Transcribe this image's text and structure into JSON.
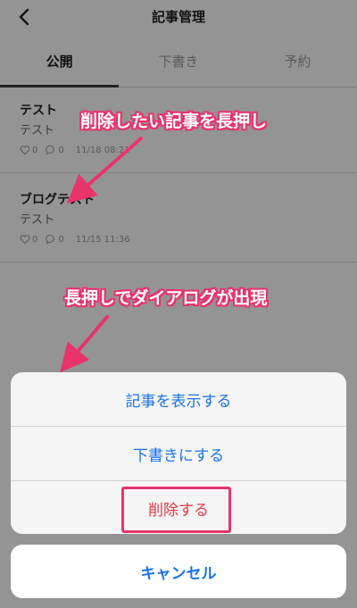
{
  "header": {
    "title": "記事管理",
    "back_icon": "chevron-left-icon"
  },
  "tabs": [
    {
      "label": "公開",
      "active": true
    },
    {
      "label": "下書き",
      "active": false
    },
    {
      "label": "予約",
      "active": false
    }
  ],
  "articles": [
    {
      "title": "テスト",
      "body": "テスト",
      "likes": "0",
      "comments": "0",
      "date": "11/18 08:21"
    },
    {
      "title": "ブログテスト",
      "body": "テスト",
      "likes": "0",
      "comments": "0",
      "date": "11/15 11:36"
    }
  ],
  "annotations": {
    "long_press": "削除したい記事を長押し",
    "dialog_appears": "長押しでダイアログが出現"
  },
  "action_sheet": {
    "view_label": "記事を表示する",
    "draft_label": "下書きにする",
    "delete_label": "削除する",
    "cancel_label": "キャンセル"
  },
  "colors": {
    "accent": "#1a73e8",
    "destructive": "#e63946",
    "annotation": "#e8336b"
  }
}
